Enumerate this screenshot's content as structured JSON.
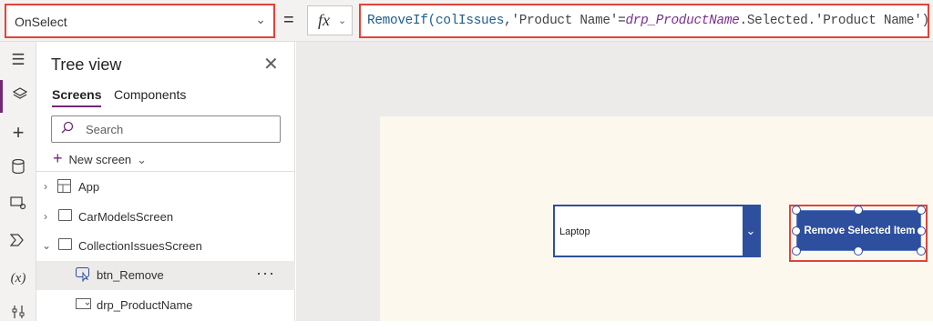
{
  "formula_bar": {
    "property": "OnSelect",
    "equals": "=",
    "fx_label": "fx",
    "formula_parts": {
      "fn": "RemoveIf(",
      "collection": "colIssues",
      "comma_field": ",'Product Name'",
      "eq": "=",
      "control": "drp_ProductName",
      "tail": ".Selected.'Product Name')"
    }
  },
  "rail": {
    "items": [
      "hamburger-icon",
      "layers-icon",
      "plus-icon",
      "database-icon",
      "media-icon",
      "power-automate-icon",
      "variables-icon",
      "tools-icon"
    ],
    "variables_label": "(x)"
  },
  "tree_view": {
    "title": "Tree view",
    "tabs": [
      "Screens",
      "Components"
    ],
    "search_placeholder": "Search",
    "new_screen": "New screen",
    "nodes": [
      {
        "label": "App"
      },
      {
        "label": "CarModelsScreen"
      },
      {
        "label": "CollectionIssuesScreen"
      },
      {
        "label": "btn_Remove",
        "more": "···"
      },
      {
        "label": "drp_ProductName"
      }
    ]
  },
  "canvas": {
    "dropdown_value": "Laptop",
    "button_label": "Remove Selected Item"
  },
  "colors": {
    "accent": "#742774",
    "highlight": "#e0443a",
    "control_blue": "#2e4f9e"
  }
}
